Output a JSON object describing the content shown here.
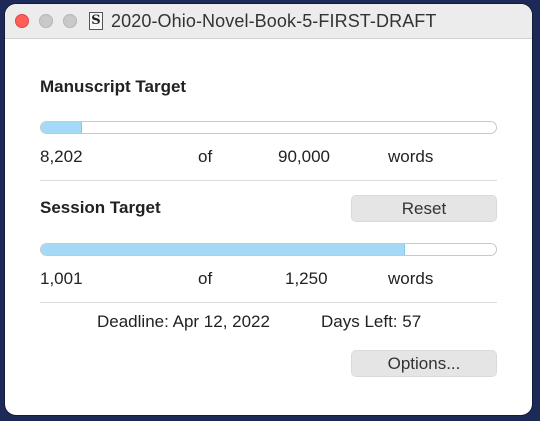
{
  "window": {
    "title": "2020-Ohio-Novel-Book-5-FIRST-DRAFT",
    "doc_icon": "S"
  },
  "manuscript": {
    "title": "Manuscript Target",
    "current": "8,202",
    "of_label": "of",
    "target": "90,000",
    "unit": "words",
    "progress_fraction": 0.091
  },
  "session": {
    "title": "Session Target",
    "reset_label": "Reset",
    "current": "1,001",
    "of_label": "of",
    "target": "1,250",
    "unit": "words",
    "progress_fraction": 0.8
  },
  "deadline": {
    "text": "Deadline: Apr 12, 2022",
    "days_left_text": "Days Left: 57"
  },
  "options_label": "Options...",
  "colors": {
    "progress_fill": "#a5daf6",
    "close_button": "#ff5f57",
    "button_bg": "#e5e5e5"
  }
}
